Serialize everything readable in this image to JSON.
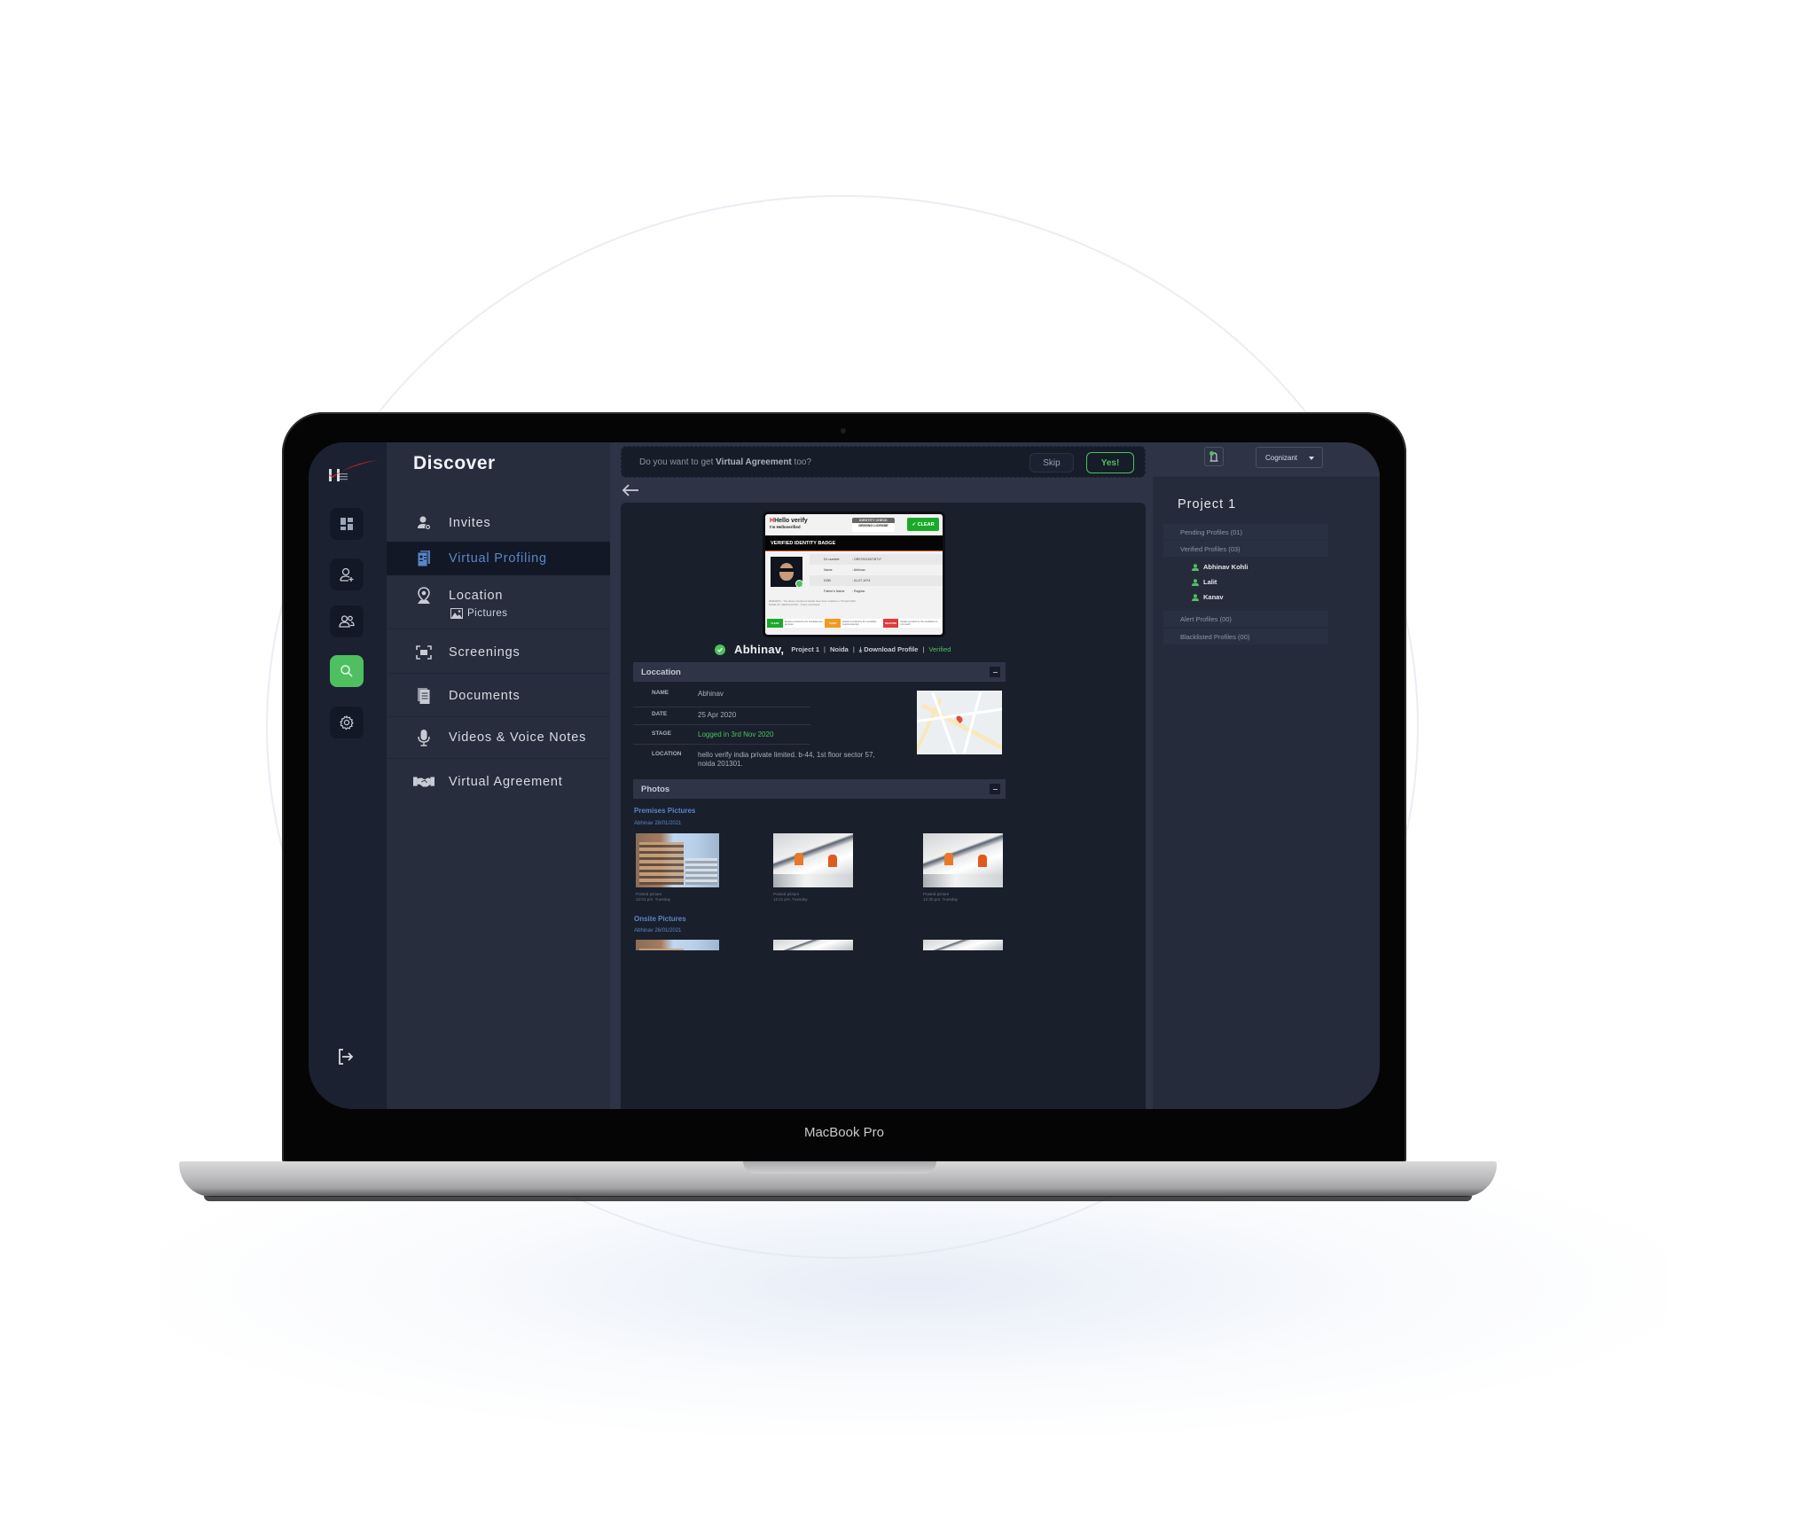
{
  "device": {
    "label": "MacBook Pro"
  },
  "app": {
    "section_title": "Discover",
    "logo": "hello-verify-logo"
  },
  "rail": {
    "items": [
      {
        "icon": "dashboard-icon",
        "active": false
      },
      {
        "icon": "add-user-icon",
        "active": false
      },
      {
        "icon": "users-icon",
        "active": false
      },
      {
        "icon": "search-icon",
        "active": true
      },
      {
        "icon": "gear-icon",
        "active": false
      }
    ],
    "logout_icon": "logout-icon"
  },
  "nav": {
    "items": [
      {
        "label": "Invites",
        "icon": "invite-user-icon"
      },
      {
        "label": "Virtual Profiling",
        "icon": "profile-card-icon",
        "active": true
      },
      {
        "label": "Location",
        "icon": "location-pin-icon"
      },
      {
        "label": "Screenings",
        "icon": "scan-icon"
      },
      {
        "label": "Documents",
        "icon": "documents-icon"
      },
      {
        "label": "Videos & Voice Notes",
        "icon": "microphone-icon"
      },
      {
        "label": "Virtual Agreement",
        "icon": "handshake-icon"
      }
    ],
    "sub_items": [
      {
        "label": "Pictures",
        "icon": "image-icon"
      }
    ]
  },
  "banner": {
    "text_prefix": "Do you want to get ",
    "text_bold": "Virtual Agreement",
    "text_suffix": " too?",
    "skip_label": "Skip",
    "yes_label": "Yes!"
  },
  "badge": {
    "brand": "Hello verify",
    "brand_tagline": "I'm Helloverified",
    "check_title": "IDENTITY CHECK",
    "check_type": "DRIVING LICENSE",
    "status": "CLEAR",
    "title": "VERIFIED IDENTITY BADGE",
    "fields": [
      {
        "key": "DL number",
        "value": ": OR0720110278717"
      },
      {
        "key": "Name",
        "value": ": Abhinav"
      },
      {
        "key": "DOB",
        "value": ": 01-07-1974"
      },
      {
        "key": "Father's Name",
        "value": ": Raghav"
      }
    ],
    "remarks": "REMARKS - The above mentioned details have been verified on 7th April 2020.",
    "mode": "MODE OF VERIFICATION : Online Verification",
    "legend": [
      {
        "label": "CLEAR",
        "desc": "Details provided by the candidate are accurate",
        "color": "#1aaa2a"
      },
      {
        "label": "ALERT",
        "desc": "Details provided by the candidate require attention",
        "color": "#f29a1f"
      },
      {
        "label": "NEGATIVE",
        "desc": "Details provided by the candidate do not match",
        "color": "#e03b3b"
      }
    ]
  },
  "profile": {
    "name": "Abhinav,",
    "project": "Project 1",
    "city": "Noida",
    "download_label": "Download Profile",
    "status": "Verified"
  },
  "location_section": {
    "title": "Loccation",
    "rows": [
      {
        "key": "NAME",
        "value": "Abhinav"
      },
      {
        "key": "DATE",
        "value": "25 Apr 2020"
      },
      {
        "key": "STAGE",
        "value": "Logged in 3rd Nov 2020"
      },
      {
        "key": "LOCATION",
        "value": "hello verify india private limited. b-44, 1st floor sector 57, noida 201301."
      }
    ]
  },
  "photos_section": {
    "title": "Photos",
    "groups": [
      {
        "title": "Premises Pictures",
        "date": "Abhinav 28/01/2021",
        "photos": [
          {
            "caption": "Posted picture",
            "time": "12:01 pm. Tuesday"
          },
          {
            "caption": "Posted picture",
            "time": "12:11 pm. Tuesday"
          },
          {
            "caption": "Posted picture",
            "time": "12:30 pm. Tuesday"
          }
        ]
      },
      {
        "title": "Onsite Pictures",
        "date": "Abhinav 26/01/2021"
      }
    ]
  },
  "right_panel": {
    "org_selected": "Cognizant",
    "project_title": "Project 1",
    "groups": [
      {
        "label": "Pending Profiles (01)"
      },
      {
        "label": "Verified Profiles (03)"
      },
      {
        "label": "Alert Profiles (00)"
      },
      {
        "label": "Blacklisted Profiles (00)"
      }
    ],
    "verified_people": [
      "Abhinav Kohli",
      "Lalit",
      "Kanav"
    ]
  },
  "colors": {
    "accent_green": "#4fc05f",
    "accent_blue": "#5a86c6",
    "bg_dark": "#1a1f2c"
  }
}
